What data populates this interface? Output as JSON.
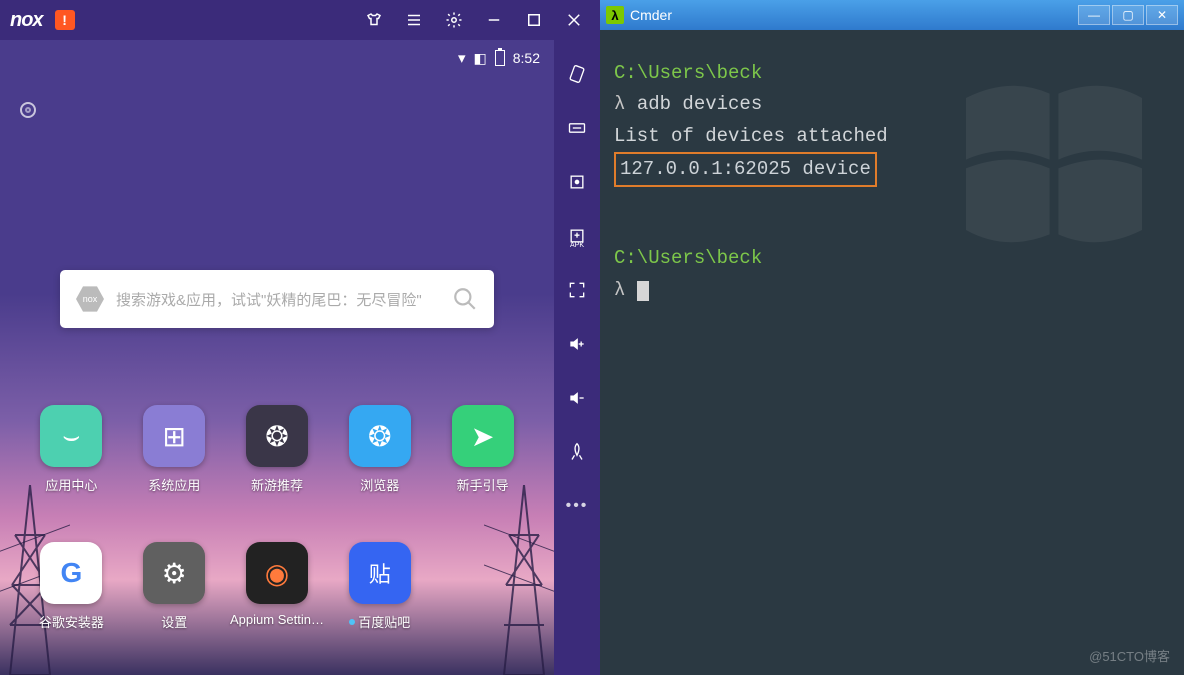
{
  "nox": {
    "logo": "nox",
    "warn_glyph": "!",
    "statusbar": {
      "time": "8:52"
    },
    "search": {
      "placeholder": "搜索游戏&应用，试试\"妖精的尾巴：无尽冒险\"",
      "hex_label": "nox"
    },
    "apps": [
      {
        "name": "应用中心",
        "bg": "#4dd0b0",
        "glyph": "⌣"
      },
      {
        "name": "系统应用",
        "bg": "#6a5acd",
        "glyph": "⊞"
      },
      {
        "name": "新游推荐",
        "bg": "#3a3648",
        "glyph": "◐"
      },
      {
        "name": "浏览器",
        "bg": "#35a8f2",
        "glyph": "❂"
      },
      {
        "name": "新手引导",
        "bg": "#35d07a",
        "glyph": "➤"
      },
      {
        "name": "谷歌安装器",
        "bg": "#fff",
        "glyph": "G",
        "fg": "#4285F4"
      },
      {
        "name": "设置",
        "bg": "#555",
        "glyph": "⚙"
      },
      {
        "name": "Appium Settin…",
        "bg": "#222",
        "glyph": "◉",
        "fg": "#ff7a3c"
      },
      {
        "name": "百度贴吧",
        "bg": "#3565f2",
        "glyph": "贴",
        "dot": true
      }
    ]
  },
  "cmder": {
    "title": "Cmder",
    "icon_glyph": "λ",
    "lines": {
      "path1": "C:\\Users\\beck",
      "sym1": "λ",
      "cmd1": "adb devices",
      "out1": "List of devices attached",
      "out2": "127.0.0.1:62025 device",
      "path2": "C:\\Users\\beck",
      "sym2": "λ"
    }
  },
  "watermark": "@51CTO博客"
}
